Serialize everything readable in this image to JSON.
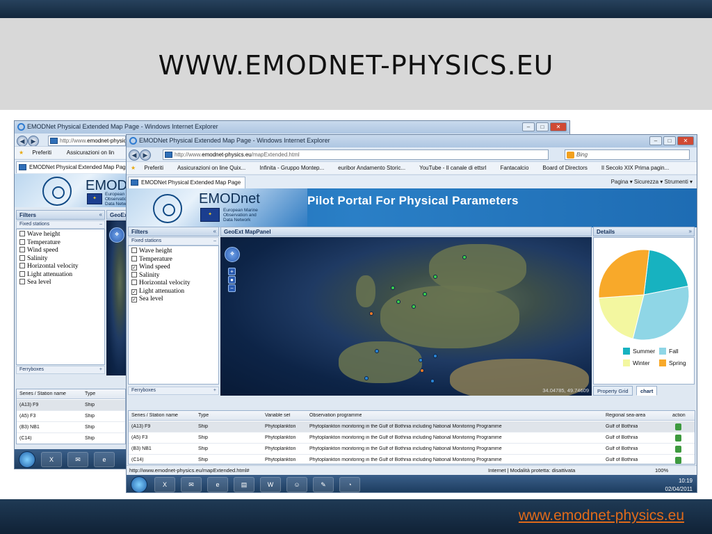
{
  "slide": {
    "title": "WWW.EMODNET-PHYSICS.EU",
    "footer_link": "www.emodnet-physics.eu"
  },
  "back_window": {
    "title": "EMODNet Physical Extended Map Page - Windows Internet Explorer",
    "address": "http://www.",
    "address_domain": "emodnet-physic",
    "fav_preferiti": "Preferiti",
    "fav_assicurazioni": "Assicurazioni on lin",
    "tab_label": "EMODNet Physical Extended Map Page",
    "brand": "EMOD",
    "brand_sub": [
      "European",
      "Observatio",
      "Data Netw"
    ],
    "filters_title": "Filters",
    "fixed_stations": "Fixed stations",
    "map_title": "GeoExt",
    "filters": [
      {
        "label": "Wave height",
        "checked": false
      },
      {
        "label": "Temperature",
        "checked": false
      },
      {
        "label": "Wind speed",
        "checked": false
      },
      {
        "label": "Salinity",
        "checked": false
      },
      {
        "label": "Horizontal velocity",
        "checked": false
      },
      {
        "label": "Light attenuation",
        "checked": false
      },
      {
        "label": "Sea level",
        "checked": false
      }
    ],
    "ferryboxes": "Ferryboxes",
    "grid_headers": [
      "Series / Station name",
      "Type"
    ],
    "grid_rows": [
      [
        "(A13) F9",
        "Ship"
      ],
      [
        "(A5) F3",
        "Ship"
      ],
      [
        "(B3) NB1",
        "Ship"
      ],
      [
        "(C14)",
        "Ship"
      ]
    ]
  },
  "front_window": {
    "title": "EMODNet Physical Extended Map Page - Windows Internet Explorer",
    "address_prefix": "http://www.",
    "address_domain": "emodnet-physics.eu",
    "address_path": "/mapExtended.html",
    "search_placeholder": "Bing",
    "favorites": [
      "Preferiti",
      "Assicurazioni on line Quix...",
      "Infinita - Gruppo Montep...",
      "euribor Andamento Storic...",
      "YouTube - Il canale di ettsrl",
      "Fantacalcio",
      "Board of Directors",
      "Il Secolo XIX  Prima pagin..."
    ],
    "tab_label": "EMODNet Physical Extended Map Page",
    "tab_tools": "Pagina ▾  Sicurezza ▾  Strumenti ▾",
    "brand": "EMODnet",
    "brand_sub": [
      "European Marine",
      "Observation and",
      "Data Network"
    ],
    "pilot_title": "Pilot Portal For Physical Parameters",
    "filters_title": "Filters",
    "fixed_stations": "Fixed stations",
    "filters": [
      {
        "label": "Wave height",
        "checked": false
      },
      {
        "label": "Temperature",
        "checked": false
      },
      {
        "label": "Wind speed",
        "checked": true
      },
      {
        "label": "Salinity",
        "checked": false
      },
      {
        "label": "Horizontal velocity",
        "checked": false
      },
      {
        "label": "Light attenuation",
        "checked": true
      },
      {
        "label": "Sea level",
        "checked": true
      }
    ],
    "ferryboxes": "Ferryboxes",
    "map_title": "GeoExt MapPanel",
    "map_coords": "34.04785, 49.74609",
    "details_title": "Details",
    "pie_legend": [
      "Summer",
      "Fall",
      "Winter",
      "Spring"
    ],
    "panel_tabs": [
      "Property Grid",
      "chart"
    ],
    "grid_headers": [
      "Series / Station name",
      "Type",
      "Variable set",
      "Observation programme",
      "Regional sea-area",
      "action"
    ],
    "grid_rows": [
      [
        "(A13) F9",
        "Ship",
        "Phytoplankton",
        "Phytoplankton monitoring in the Gulf of Bothnia including National Monitoring Programme",
        "Gulf of Bothnia"
      ],
      [
        "(A5) F3",
        "Ship",
        "Phytoplankton",
        "Phytoplankton monitoring in the Gulf of Bothnia including National Monitoring Programme",
        "Gulf of Bothnia"
      ],
      [
        "(B3) NB1",
        "Ship",
        "Phytoplankton",
        "Phytoplankton monitoring in the Gulf of Bothnia including National Monitoring Programme",
        "Gulf of Bothnia"
      ],
      [
        "(C14)",
        "Ship",
        "Phytoplankton",
        "Phytoplankton monitoring in the Gulf of Bothnia including National Monitoring Programme",
        "Gulf of Bothnia"
      ]
    ],
    "status_url": "http://www.emodnet-physics.eu/mapExtended.html#",
    "status_zone": "Internet | Modalità protetta: disattivata",
    "status_zoom": "100%",
    "clock_time": "10:19",
    "clock_date": "02/04/2011"
  },
  "chart_data": {
    "type": "pie",
    "categories": [
      "Summer",
      "Fall",
      "Winter",
      "Spring"
    ],
    "values": [
      20,
      32,
      20,
      28
    ],
    "colors": [
      "#17b2c0",
      "#8fd6e6",
      "#f3f7a0",
      "#f8a92a"
    ]
  },
  "map_markers": [
    {
      "lon": 1.5,
      "lat": 51.9,
      "color": "#3bd14a"
    },
    {
      "lon": 3.5,
      "lat": 54.5,
      "color": "#3bd14a"
    },
    {
      "lon": 11.0,
      "lat": 62.0,
      "color": "#3bd14a"
    },
    {
      "lon": 5.5,
      "lat": 58.0,
      "color": "#3bd14a"
    },
    {
      "lon": -1.5,
      "lat": 52.9,
      "color": "#3bd14a"
    },
    {
      "lon": -2.5,
      "lat": 55.8,
      "color": "#3bd14a"
    },
    {
      "lon": -6.5,
      "lat": 50.5,
      "color": "#f07a26"
    },
    {
      "lon": -5.5,
      "lat": 43.0,
      "color": "#2a86d6"
    },
    {
      "lon": 2.8,
      "lat": 41.2,
      "color": "#2a86d6"
    },
    {
      "lon": 5.5,
      "lat": 42.0,
      "color": "#2a86d6"
    },
    {
      "lon": 3.0,
      "lat": 39.0,
      "color": "#f07a26"
    },
    {
      "lon": -7.5,
      "lat": 37.5,
      "color": "#2a86d6"
    },
    {
      "lon": 5.0,
      "lat": 37.0,
      "color": "#2a86d6"
    }
  ]
}
